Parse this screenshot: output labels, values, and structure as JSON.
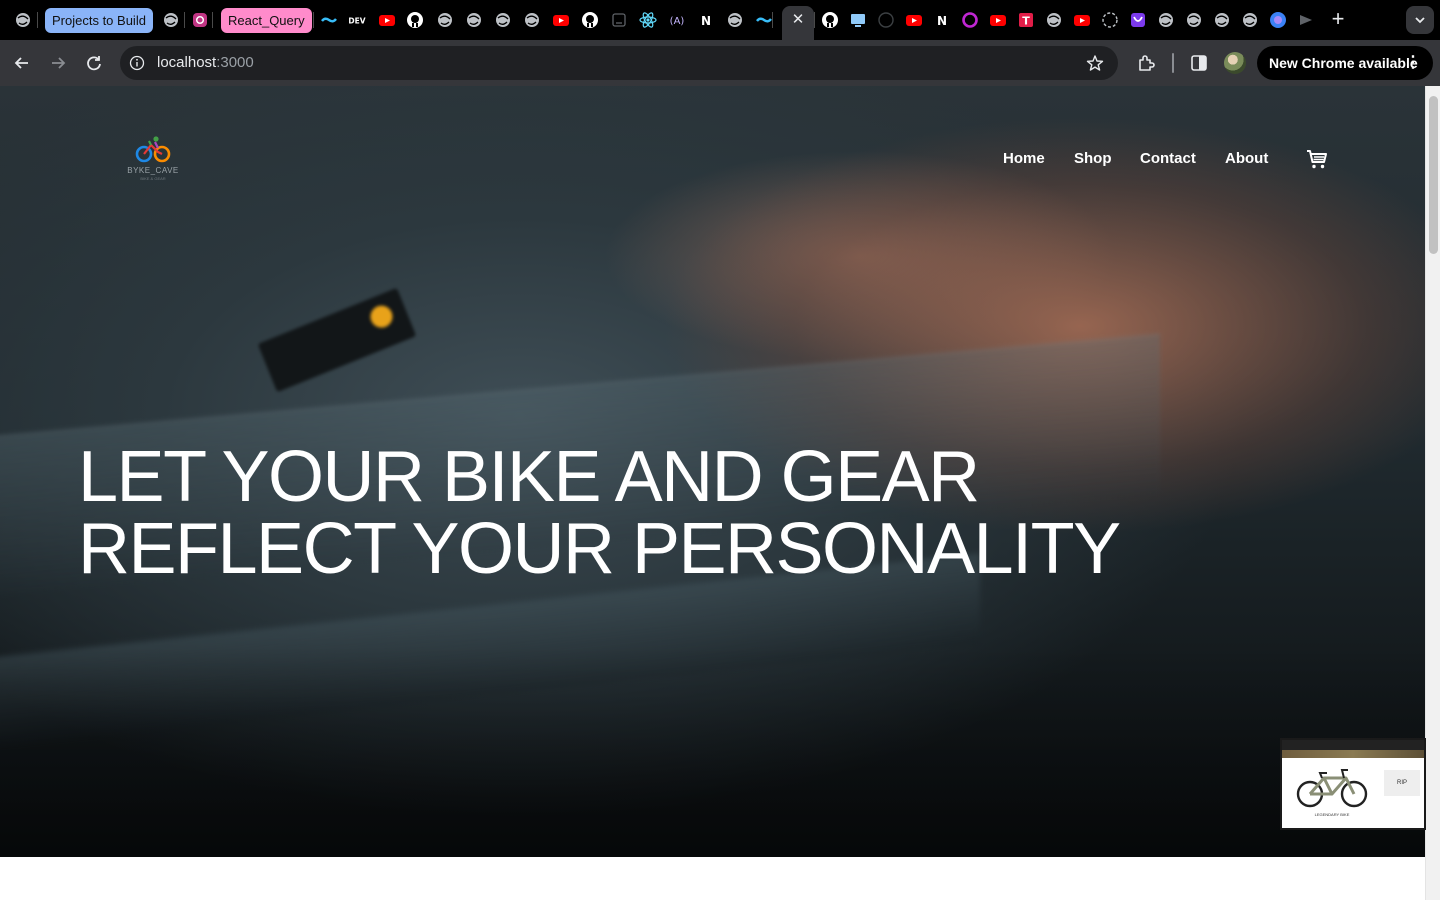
{
  "browser": {
    "tab_groups": [
      {
        "label": "Projects to Build",
        "color": "#8ab4f8"
      },
      {
        "label": "React_Query",
        "color": "#ff8bcb"
      }
    ],
    "active_tab_close": "✕",
    "new_tab": "+",
    "url_host": "localhost",
    "url_port": ":3000",
    "update_button": "New Chrome available",
    "update_menu": "⋮"
  },
  "site": {
    "logo_text": "BYKE_CAVE",
    "logo_sub": "BIKE & GEAR",
    "nav": [
      {
        "label": "Home"
      },
      {
        "label": "Shop"
      },
      {
        "label": "Contact"
      },
      {
        "label": "About"
      }
    ],
    "cart_icon": "shopping-cart-icon",
    "hero": {
      "line1": "LET YOUR BIKE AND GEAR",
      "line2": "REFLECT YOUR PERSONALITY"
    }
  },
  "pip_preview": {
    "card_text": "RIP",
    "caption": "LEGENDARY BIKE"
  }
}
